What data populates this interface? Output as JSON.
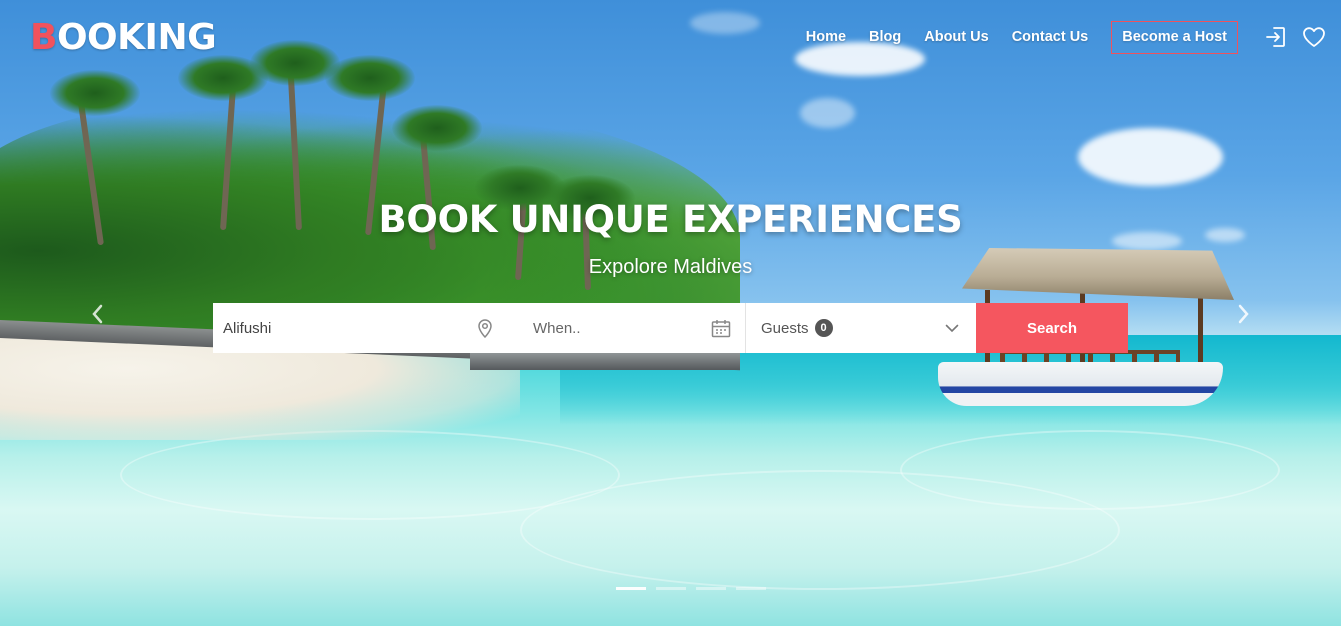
{
  "brand": {
    "logo_first": "B",
    "logo_rest": "OOKING",
    "accent_color": "#f5565f"
  },
  "nav": {
    "links": [
      "Home",
      "Blog",
      "About Us",
      "Contact Us"
    ],
    "host_button": "Become a Host",
    "icons": [
      "login-icon",
      "heart-icon"
    ]
  },
  "hero": {
    "title": "BOOK UNIQUE EXPERIENCES",
    "subtitle": "Expolore Maldives"
  },
  "search": {
    "location_value": "Alifushi",
    "date_placeholder": "When..",
    "guests_label": "Guests",
    "guests_count": "0",
    "button_label": "Search",
    "icons": [
      "location-pin-icon",
      "calendar-icon",
      "chevron-down-icon"
    ]
  },
  "carousel": {
    "slides": 4,
    "active_index": 0
  }
}
